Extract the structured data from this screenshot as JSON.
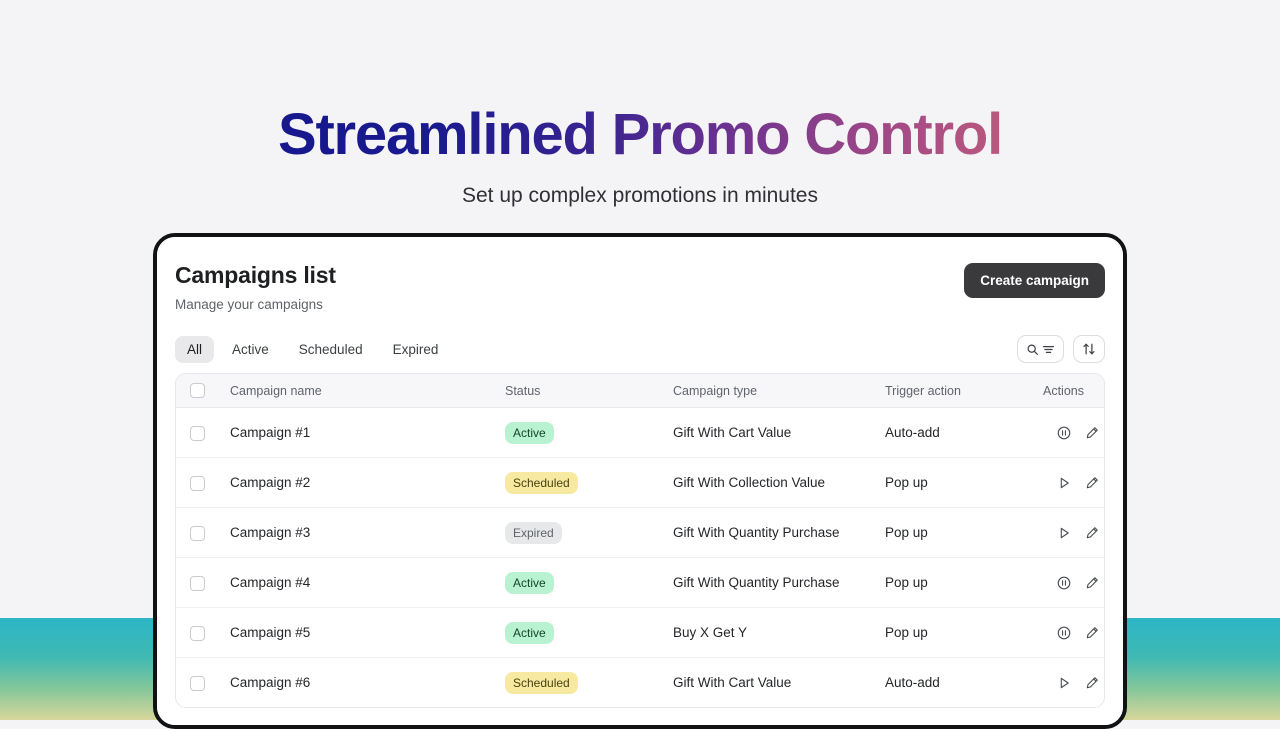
{
  "hero": {
    "title": "Streamlined Promo Control",
    "subtitle": "Set up complex promotions in minutes",
    "gradient_start": "#13138c",
    "gradient_end": "#cf6a77"
  },
  "page_background": "#f4f4f7",
  "decor": {
    "band_gradient_top": "#2cb5c5",
    "band_gradient_bottom": "#d8d79a"
  },
  "card": {
    "title": "Campaigns list",
    "subtitle": "Manage your campaigns",
    "create_button": "Create campaign",
    "create_button_bg": "#3a3a3c"
  },
  "tabs": [
    {
      "label": "All",
      "active": true
    },
    {
      "label": "Active",
      "active": false
    },
    {
      "label": "Scheduled",
      "active": false
    },
    {
      "label": "Expired",
      "active": false
    }
  ],
  "tools": [
    {
      "name": "search-filter-button",
      "icons": [
        "search-icon",
        "filter-lines-icon"
      ]
    },
    {
      "name": "sort-button",
      "icons": [
        "sort-arrows-icon"
      ]
    }
  ],
  "table": {
    "headers": {
      "select": "",
      "name": "Campaign name",
      "status": "Status",
      "type": "Campaign type",
      "trigger": "Trigger action",
      "actions": "Actions"
    },
    "rows": [
      {
        "name": "Campaign #1",
        "status": "Active",
        "status_kind": "active",
        "type": "Gift With Cart Value",
        "trigger": "Auto-add",
        "toggle_icon": "pause-circle-icon",
        "checked": false
      },
      {
        "name": "Campaign #2",
        "status": "Scheduled",
        "status_kind": "scheduled",
        "type": "Gift With Collection Value",
        "trigger": "Pop up",
        "toggle_icon": "play-icon",
        "checked": false
      },
      {
        "name": "Campaign #3",
        "status": "Expired",
        "status_kind": "expired",
        "type": "Gift With Quantity Purchase",
        "trigger": "Pop up",
        "toggle_icon": "play-icon",
        "checked": false
      },
      {
        "name": "Campaign #4",
        "status": "Active",
        "status_kind": "active",
        "type": "Gift With Quantity Purchase",
        "trigger": "Pop up",
        "toggle_icon": "pause-circle-icon",
        "checked": false
      },
      {
        "name": "Campaign #5",
        "status": "Active",
        "status_kind": "active",
        "type": "Buy X Get Y",
        "trigger": "Pop up",
        "toggle_icon": "pause-circle-icon",
        "checked": false
      },
      {
        "name": "Campaign #6",
        "status": "Scheduled",
        "status_kind": "scheduled",
        "type": "Gift With Cart Value",
        "trigger": "Auto-add",
        "toggle_icon": "play-icon",
        "checked": false
      }
    ]
  },
  "status_colors": {
    "active_bg": "#b8f2d0",
    "scheduled_bg": "#f7e9a0",
    "expired_bg": "#e7e8ea"
  }
}
